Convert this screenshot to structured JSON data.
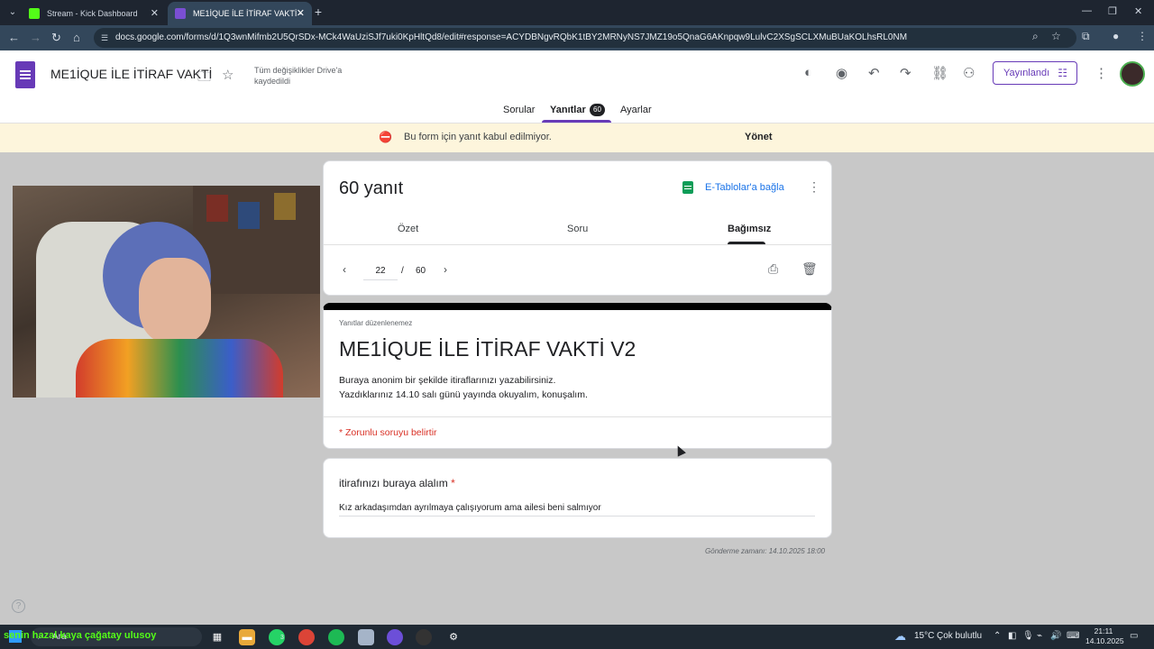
{
  "browser": {
    "tabs": [
      {
        "title": "Stream - Kick Dashboard"
      },
      {
        "title": "ME1İQUE İLE İTİRAF VAKTİ - Go"
      }
    ],
    "url": "docs.google.com/forms/d/1Q3wnMifmb2U5QrSDx-MCk4WaUziSJf7uki0KpHltQd8/edit#response=ACYDBNgvRQbK1tBY2MRNyNS7JMZ19o5QnaG6AKnpqw9LulvC2XSgSCLXMuBUaKOLhsRL0NM"
  },
  "forms_header": {
    "title": "ME1İQUE İLE İTİRAF VAKTİ",
    "saved_status": "Tüm değişiklikler Drive'a kaydedildi",
    "publish_label": "Yayınlandı",
    "tabs": {
      "questions": "Sorular",
      "responses": "Yanıtlar",
      "responses_count": "60",
      "settings": "Ayarlar"
    }
  },
  "banner": {
    "message": "Bu form için yanıt kabul edilmiyor.",
    "action": "Yönet"
  },
  "summary": {
    "response_count_label": "60 yanıt",
    "sheets_link": "E-Tablolar'a bağla",
    "tabs": {
      "summary": "Özet",
      "question": "Soru",
      "individual": "Bağımsız"
    },
    "pager": {
      "current": "22",
      "separator": "/",
      "total": "60"
    }
  },
  "form": {
    "uneditable_note": "Yanıtlar düzenlenemez",
    "title": "ME1İQUE İLE İTİRAF VAKTİ V2",
    "description_line1": "Buraya anonim bir şekilde itiraflarınızı yazabilirsiniz.",
    "description_line2": "Yazdıklarınız 14.10 salı günü yayında okuyalım, konuşalım.",
    "required_note": "* Zorunlu soruyu belirtir"
  },
  "question": {
    "label": "itirafınızı buraya alalım",
    "required_mark": "*",
    "answer": "Kız arkadaşımdan ayrılmaya çalışıyorum ama ailesi beni salmıyor"
  },
  "submitted_at": "Gönderme zamanı: 14.10.2025 18:00",
  "taskbar": {
    "search_text": "Ara",
    "ticker_text": "senin hazal kaya çağatay ulusoy",
    "weather_temp": "15°C",
    "weather_desc": "Çok bulutlu",
    "time": "21:11",
    "date": "14.10.2025",
    "whatsapp_badge": "3"
  },
  "colors": {
    "forms_accent": "#673ab7",
    "banner_bg": "#fdf5dc",
    "required_red": "#d93025",
    "link_blue": "#1a73e8",
    "sheets_green": "#0f9d58"
  }
}
